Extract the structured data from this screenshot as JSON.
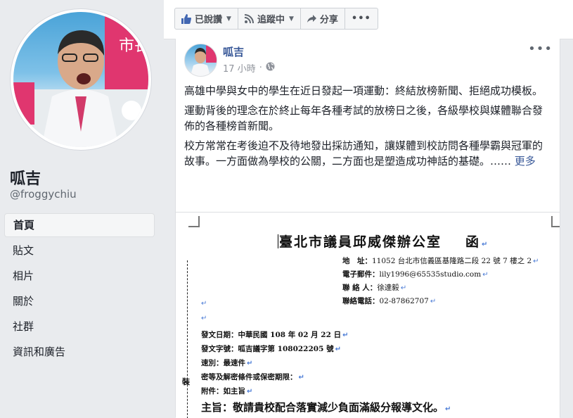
{
  "profile": {
    "name": "呱吉",
    "handle": "@froggychiu",
    "photo_sign_text": "市長"
  },
  "sidebar": {
    "items": [
      {
        "label": "首頁",
        "active": true
      },
      {
        "label": "貼文"
      },
      {
        "label": "相片"
      },
      {
        "label": "關於"
      },
      {
        "label": "社群"
      },
      {
        "label": "資訊和廣告"
      }
    ]
  },
  "topbar": {
    "liked_label": "已說讚",
    "following_label": "追蹤中",
    "share_label": "分享",
    "more_label": "•••"
  },
  "post": {
    "author": "呱吉",
    "time": "17 小時",
    "more_label": "•••",
    "paragraphs": [
      "高雄中學與女中的學生在近日發起一項運動：終結放榜新聞、拒絕成功模板。",
      "運動背後的理念在於終止每年各種考試的放榜日之後，各級學校與媒體聯合發佈的各種榜首新聞。",
      "校方常常在考後迫不及待地發出採訪通知，讓媒體到校訪問各種學霸與冠軍的故事。一方面做為學校的公關，二方面也是塑造成功神話的基礎。……"
    ],
    "see_more": "更多"
  },
  "document": {
    "title": "臺北市議員邱威傑辦公室",
    "title_suffix": "函",
    "contact": {
      "address_label": "地　址：",
      "address": "11052 台北市信義區基隆路二段 22 號 7 樓之 2",
      "email_label": "電子郵件：",
      "email": "lily1996@65535studio.com",
      "person_label": "聯 絡 人：",
      "person": "徐達毅",
      "phone_label": "聯絡電話：",
      "phone": "02-87862707"
    },
    "date_label": "發文日期：",
    "date": "中華民國 108 年 02 月 22 日",
    "number_label": "發文字號：",
    "number": "呱吉議字第 108022205 號",
    "speed_label": "速別：",
    "speed": "最速件",
    "secret_label": "密等及解密條件或保密期限：",
    "attach_label": "附件：",
    "attach": "如主旨",
    "bind_mark": "裝",
    "subject_label": "主旨：",
    "subject": "敬請貴校配合落實減少負面滿級分報導文化。",
    "para_mark": "↵"
  },
  "colors": {
    "link": "#385898",
    "background": "#e9ebee",
    "para_mark": "#4a7bd6"
  }
}
